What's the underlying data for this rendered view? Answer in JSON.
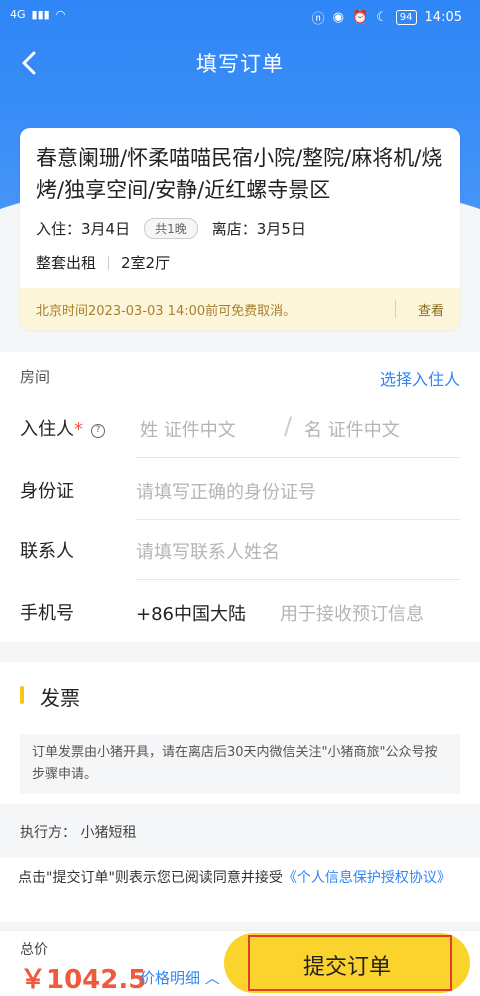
{
  "status": {
    "network": "4G",
    "time": "14:05",
    "battery": "94"
  },
  "header": {
    "title": "填写订单"
  },
  "hotel": {
    "name": "春意阑珊/怀柔喵喵民宿小院/整院/麻将机/烧烤/独享空间/安静/近红螺寺景区",
    "checkin": "入住：3月4日",
    "nights": "共1晚",
    "checkout": "离店：3月5日",
    "rent_type": "整套出租",
    "layout": "2室2厅",
    "cancel_note": "北京时间2023-03-03 14:00前可免费取消。",
    "cancel_view": "查看"
  },
  "form": {
    "section": "房间",
    "choose_guest": "选择入住人",
    "guest_label": "入住人",
    "required_mark": "*",
    "help_mark": "?",
    "surname_placeholder": "姓 证件中文",
    "given_placeholder": "名 证件中文",
    "id_label": "身份证",
    "id_placeholder": "请填写正确的身份证号",
    "contact_label": "联系人",
    "contact_placeholder": "请填写联系人姓名",
    "phone_label": "手机号",
    "phone_code": "+86中国大陆",
    "phone_placeholder": "用于接收预订信息"
  },
  "invoice": {
    "title": "发票",
    "note": "订单发票由小猪开具，请在离店后30天内微信关注\"小猪商旅\"公众号按步骤申请。"
  },
  "executor": "执行方： 小猪短租",
  "agreement": {
    "text": "点击\"提交订单\"则表示您已阅读同意并接受",
    "link": "《个人信息保护授权协议》"
  },
  "footer": {
    "total_label": "总价",
    "price": "￥1042.5",
    "detail": "价格明细 ︿",
    "submit": "提交订单"
  },
  "colors": {
    "primary": "#2f86f6",
    "accent": "#fbd32d",
    "price": "#f05a3c"
  }
}
